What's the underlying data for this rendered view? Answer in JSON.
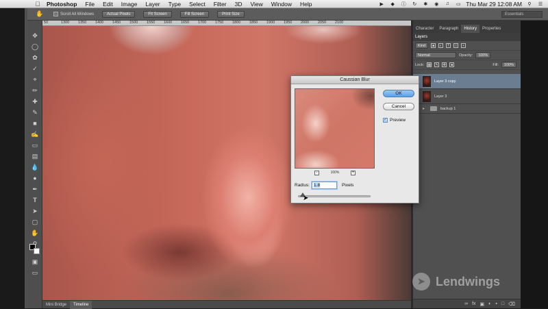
{
  "menubar": {
    "app": "Photoshop",
    "items": [
      "File",
      "Edit",
      "Image",
      "Layer",
      "Type",
      "Select",
      "Filter",
      "3D",
      "View",
      "Window",
      "Help"
    ],
    "clock": "Thu Mar 29  12:08 AM"
  },
  "options": {
    "scroll_all": "Scroll All Windows",
    "actual_pixels": "Actual Pixels",
    "fit_screen": "Fit Screen",
    "fill_screen": "Fill Screen",
    "print_size": "Print Size",
    "workspace": "Essentials"
  },
  "ruler": [
    "50",
    "1300",
    "1350",
    "1400",
    "1450",
    "1500",
    "1550",
    "1600",
    "1650",
    "1700",
    "1750",
    "1800",
    "1850",
    "1900",
    "1950",
    "2000",
    "2050",
    "2100"
  ],
  "doc_tabs": {
    "mini_bridge": "Mini Bridge",
    "timeline": "Timeline"
  },
  "panel": {
    "tabs": [
      "Character",
      "Paragraph",
      "History",
      "Properties"
    ],
    "active_tab": "History",
    "layers_tab": "Layers",
    "kind": "Kind",
    "blend_mode": "Normal",
    "opacity_label": "Opacity:",
    "opacity_value": "100%",
    "lock_label": "Lock:",
    "fill_label": "Fill:",
    "fill_value": "100%",
    "layers": [
      "Layer 3 copy",
      "Layer 3",
      "backup 1"
    ]
  },
  "dialog": {
    "title": "Caussian Blur",
    "ok": "OK",
    "cancel": "Cancel",
    "preview_label": "Preview",
    "zoom": "100%",
    "radius_label": "Radius:",
    "radius_value": "1.8",
    "units": "Pixels"
  },
  "watermark": "Lendwings"
}
